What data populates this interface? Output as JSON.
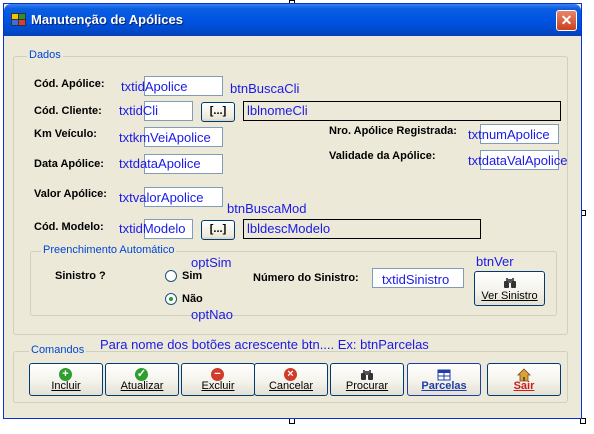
{
  "window": {
    "title": "Manutenção de Apólices",
    "close": "✕"
  },
  "dados": {
    "legend": "Dados",
    "cod_apolice": {
      "label": "Cód. Apólice:",
      "textbox": "txtidApolice",
      "button_note": "btnBuscaCli"
    },
    "cod_cliente": {
      "label": "Cód. Cliente:",
      "textbox": "txtidCli",
      "button_text": "[...]",
      "label_box": "lblnomeCli"
    },
    "km_veiculo": {
      "label": "Km Veículo:",
      "textbox": "txtkmVeiApolice"
    },
    "data_apolice": {
      "label": "Data Apólice:",
      "textbox": "txtdataApolice"
    },
    "valor_apolice": {
      "label": "Valor Apólice:",
      "textbox": "txtvalorApolice"
    },
    "cod_modelo": {
      "label": "Cód. Modelo:",
      "textbox": "txtidModelo",
      "button_text": "[...]",
      "button_note": "btnBuscaMod",
      "label_box": "lbldescModelo"
    },
    "nro_apolice": {
      "label": "Nro. Apólice Registrada:",
      "textbox": "txtnumApolice"
    },
    "validade": {
      "label": "Validade da Apólice:",
      "textbox": "txtdataValApolice"
    }
  },
  "preenchimento": {
    "legend": "Preenchimento Automático",
    "sinistro_label": "Sinistro ?",
    "opt_sim": {
      "note": "optSim",
      "label": "Sim",
      "checked": false
    },
    "opt_nao": {
      "note": "optNao",
      "label": "Não",
      "checked": true
    },
    "numero_label": "Número do Sinistro:",
    "numero_textbox": "txtidSinistro",
    "btn_ver": {
      "note": "btnVer",
      "label": "Ver Sinistro",
      "icon": "binoculars-icon"
    }
  },
  "comandos": {
    "legend": "Comandos",
    "hint": "Para nome dos botões acrescente btn.... Ex: btnParcelas",
    "buttons": [
      {
        "label": "Incluir",
        "icon": "plus-icon",
        "color": "#2e9e2e"
      },
      {
        "label": "Atualizar",
        "icon": "check-icon",
        "color": "#2e9e2e"
      },
      {
        "label": "Excluir",
        "icon": "minus-icon",
        "color": "#d23a2a"
      },
      {
        "label": "Cancelar",
        "icon": "cancel-icon",
        "color": "#d23a2a"
      },
      {
        "label": "Procurar",
        "icon": "binoculars-icon"
      },
      {
        "label": "Parcelas",
        "icon": "table-icon",
        "color": "#1f3ea8"
      },
      {
        "label": "Sair",
        "icon": "home-exit-icon",
        "color": "#cc1a1a"
      }
    ]
  },
  "colors": {
    "annotation": "#1a1ae6",
    "legend": "#0046d5",
    "form_background": "#ece9d8",
    "titlebar": "#0054e3"
  }
}
